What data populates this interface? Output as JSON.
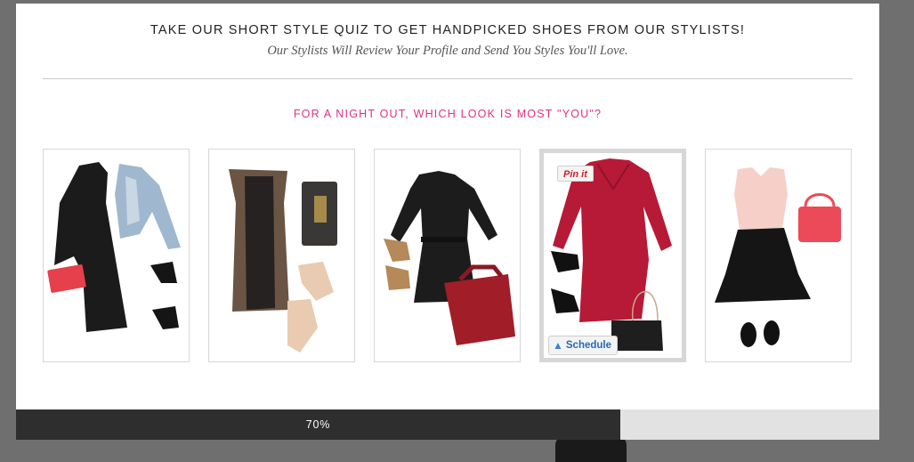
{
  "header": {
    "title": "TAKE OUR SHORT STYLE QUIZ TO GET HANDPICKED SHOES FROM OUR STYLISTS!",
    "subtitle": "Our Stylists Will Review Your Profile and Send You Styles You'll Love."
  },
  "quiz": {
    "question": "FOR A NIGHT OUT, WHICH LOOK IS MOST \"YOU\"?",
    "selected_index": 3,
    "options": [
      {
        "name": "black-dress-denim-jacket",
        "dress_color": "#1b1b1b"
      },
      {
        "name": "brown-bustier-dress",
        "dress_color": "#6a5443"
      },
      {
        "name": "black-belted-dress",
        "dress_color": "#1c1c1c"
      },
      {
        "name": "red-wrap-dress",
        "dress_color": "#b71a36"
      },
      {
        "name": "pink-top-black-skirt",
        "dress_color": "#f6cfc8"
      }
    ]
  },
  "overlays": {
    "pin_label": "Pin it",
    "schedule_label": "Schedule"
  },
  "progress": {
    "value": 0.7,
    "label": "70%"
  },
  "colors": {
    "accent": "#e0317f",
    "progress_fill": "#2e2e2e",
    "progress_track": "#e2e2e2"
  }
}
